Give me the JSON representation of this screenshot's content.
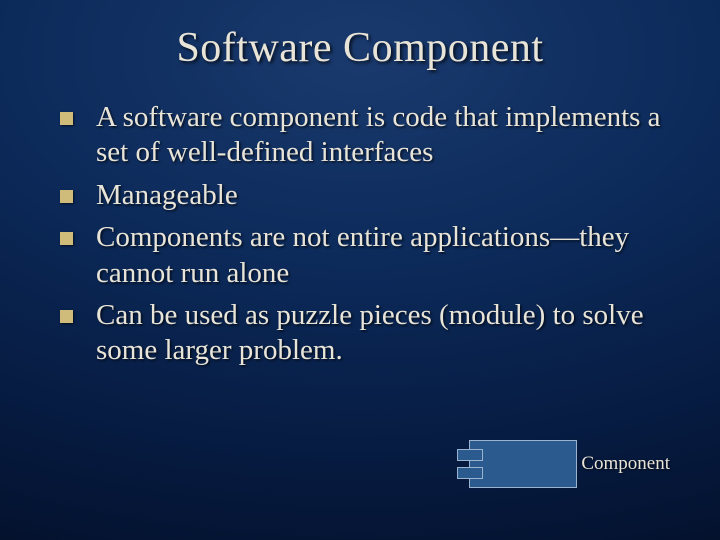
{
  "title": "Software Component",
  "bullets": [
    "A software component is code that implements a set of well-defined interfaces",
    "Manageable",
    "Components are not entire applications—they cannot run alone",
    "Can be used as puzzle pieces (module) to solve some larger problem."
  ],
  "diagram": {
    "label": "Component"
  }
}
